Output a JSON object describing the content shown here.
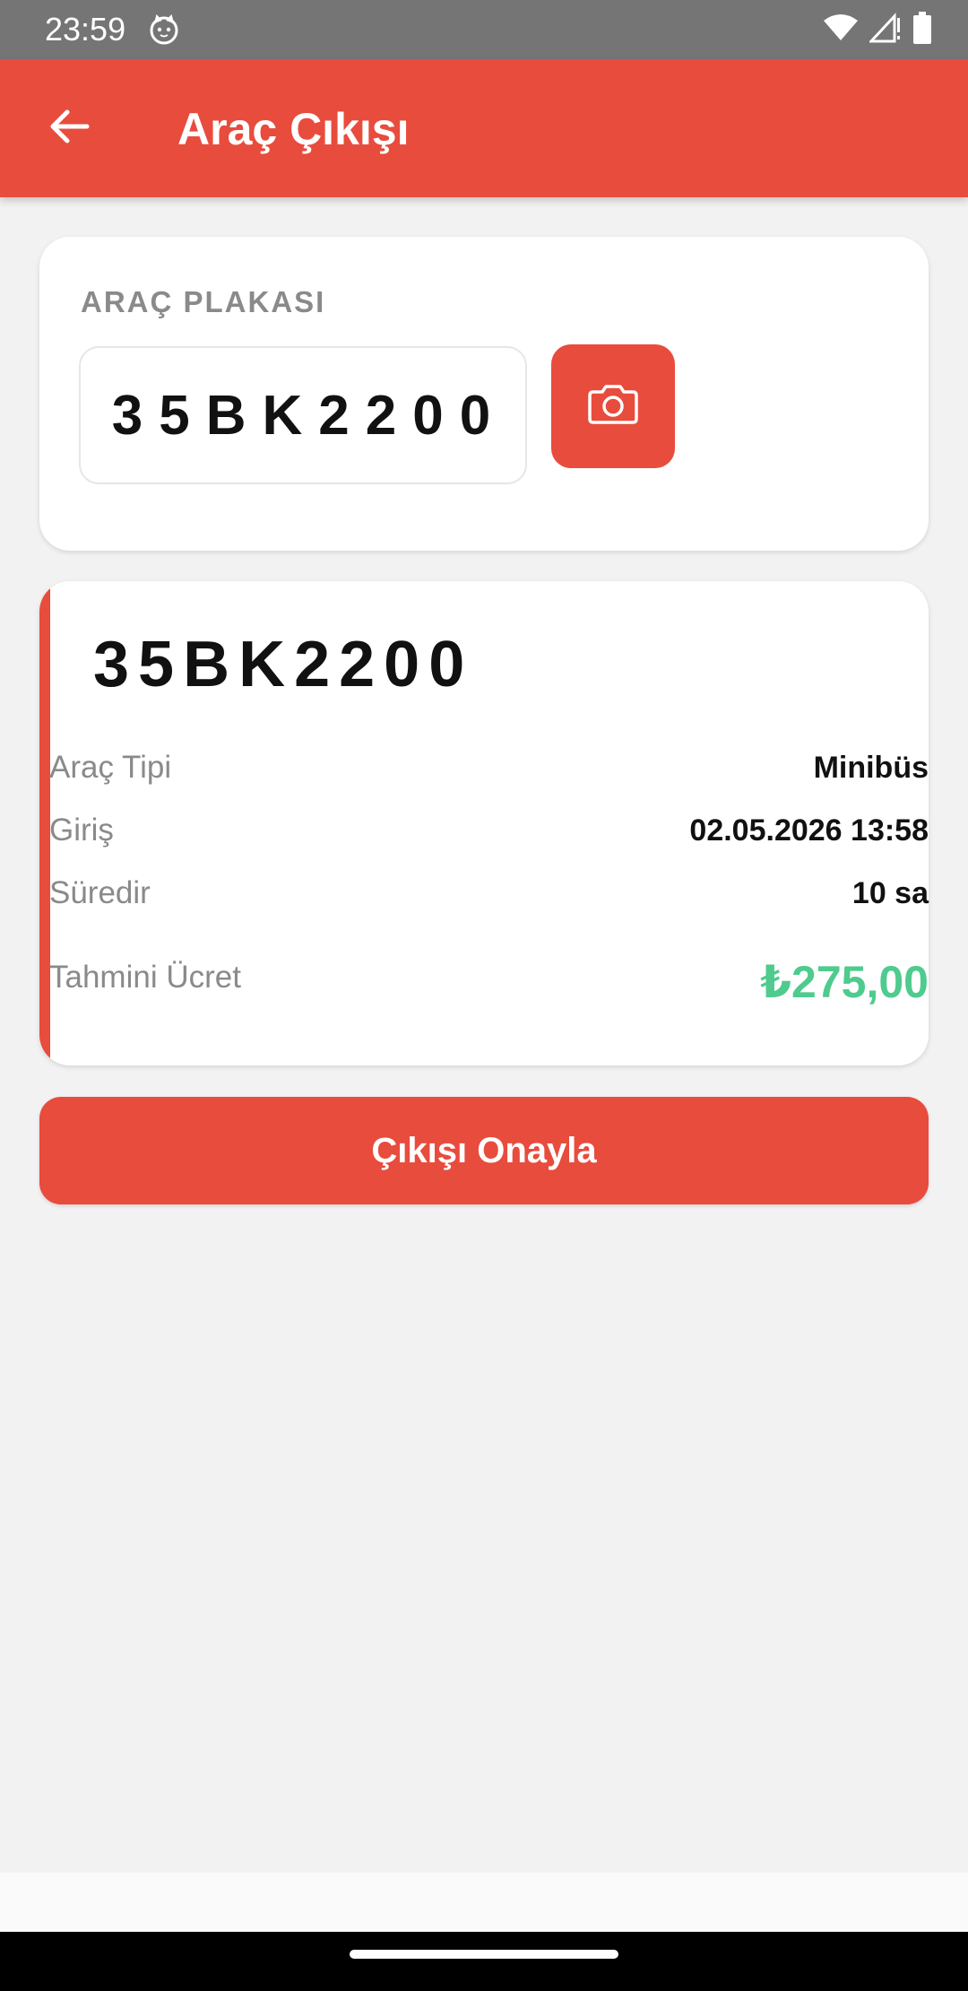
{
  "status_bar": {
    "time": "23:59",
    "icons": [
      "cat-icon",
      "wifi-icon",
      "signal-icon",
      "battery-icon"
    ]
  },
  "app_bar": {
    "title": "Araç Çıkışı",
    "back_icon": "arrow-left-icon"
  },
  "plate_section": {
    "label": "ARAÇ PLAKASI",
    "input_value": "35BK2200",
    "camera_icon": "camera-icon"
  },
  "vehicle_info": {
    "plate": "35BK2200",
    "rows": [
      {
        "label": "Araç Tipi",
        "value": "Minibüs"
      },
      {
        "label": "Giriş",
        "value": "02.05.2026 13:58"
      },
      {
        "label": "Süredir",
        "value": "10 sa"
      }
    ],
    "fee_label": "Tahmini Ücret",
    "fee_value": "₺275,00"
  },
  "confirm_button": {
    "label": "Çıkışı Onayla"
  },
  "colors": {
    "primary": "#e84c3d",
    "fee": "#4ecb8d",
    "background": "#f3f2f3",
    "status_bar": "#757575"
  }
}
